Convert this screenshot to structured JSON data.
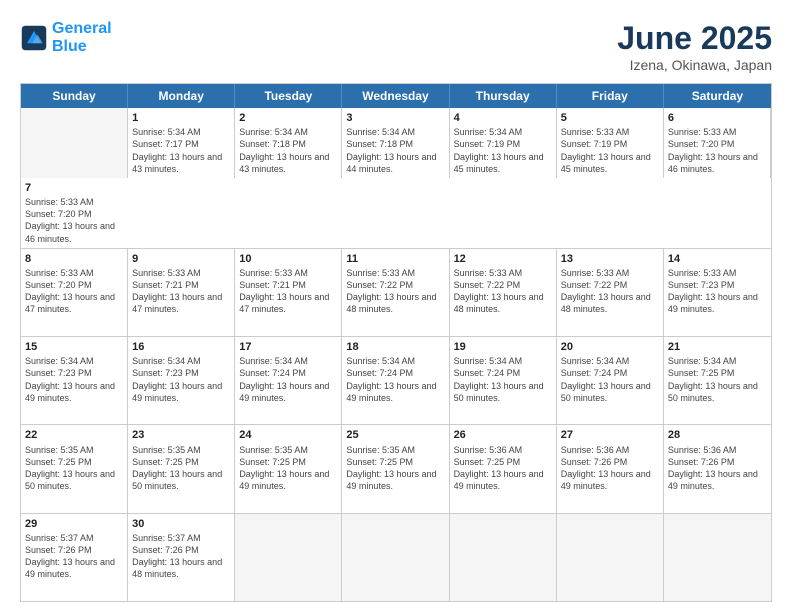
{
  "logo": {
    "line1": "General",
    "line2": "Blue"
  },
  "title": "June 2025",
  "location": "Izena, Okinawa, Japan",
  "header_days": [
    "Sunday",
    "Monday",
    "Tuesday",
    "Wednesday",
    "Thursday",
    "Friday",
    "Saturday"
  ],
  "rows": [
    [
      {
        "day": "",
        "empty": true
      },
      {
        "day": "1",
        "sunrise": "5:34 AM",
        "sunset": "7:17 PM",
        "daylight": "13 hours and 43 minutes."
      },
      {
        "day": "2",
        "sunrise": "5:34 AM",
        "sunset": "7:18 PM",
        "daylight": "13 hours and 43 minutes."
      },
      {
        "day": "3",
        "sunrise": "5:34 AM",
        "sunset": "7:18 PM",
        "daylight": "13 hours and 44 minutes."
      },
      {
        "day": "4",
        "sunrise": "5:34 AM",
        "sunset": "7:19 PM",
        "daylight": "13 hours and 45 minutes."
      },
      {
        "day": "5",
        "sunrise": "5:33 AM",
        "sunset": "7:19 PM",
        "daylight": "13 hours and 45 minutes."
      },
      {
        "day": "6",
        "sunrise": "5:33 AM",
        "sunset": "7:20 PM",
        "daylight": "13 hours and 46 minutes."
      },
      {
        "day": "7",
        "sunrise": "5:33 AM",
        "sunset": "7:20 PM",
        "daylight": "13 hours and 46 minutes."
      }
    ],
    [
      {
        "day": "8",
        "sunrise": "5:33 AM",
        "sunset": "7:20 PM",
        "daylight": "13 hours and 47 minutes."
      },
      {
        "day": "9",
        "sunrise": "5:33 AM",
        "sunset": "7:21 PM",
        "daylight": "13 hours and 47 minutes."
      },
      {
        "day": "10",
        "sunrise": "5:33 AM",
        "sunset": "7:21 PM",
        "daylight": "13 hours and 47 minutes."
      },
      {
        "day": "11",
        "sunrise": "5:33 AM",
        "sunset": "7:22 PM",
        "daylight": "13 hours and 48 minutes."
      },
      {
        "day": "12",
        "sunrise": "5:33 AM",
        "sunset": "7:22 PM",
        "daylight": "13 hours and 48 minutes."
      },
      {
        "day": "13",
        "sunrise": "5:33 AM",
        "sunset": "7:22 PM",
        "daylight": "13 hours and 48 minutes."
      },
      {
        "day": "14",
        "sunrise": "5:33 AM",
        "sunset": "7:23 PM",
        "daylight": "13 hours and 49 minutes."
      }
    ],
    [
      {
        "day": "15",
        "sunrise": "5:34 AM",
        "sunset": "7:23 PM",
        "daylight": "13 hours and 49 minutes."
      },
      {
        "day": "16",
        "sunrise": "5:34 AM",
        "sunset": "7:23 PM",
        "daylight": "13 hours and 49 minutes."
      },
      {
        "day": "17",
        "sunrise": "5:34 AM",
        "sunset": "7:24 PM",
        "daylight": "13 hours and 49 minutes."
      },
      {
        "day": "18",
        "sunrise": "5:34 AM",
        "sunset": "7:24 PM",
        "daylight": "13 hours and 49 minutes."
      },
      {
        "day": "19",
        "sunrise": "5:34 AM",
        "sunset": "7:24 PM",
        "daylight": "13 hours and 50 minutes."
      },
      {
        "day": "20",
        "sunrise": "5:34 AM",
        "sunset": "7:24 PM",
        "daylight": "13 hours and 50 minutes."
      },
      {
        "day": "21",
        "sunrise": "5:34 AM",
        "sunset": "7:25 PM",
        "daylight": "13 hours and 50 minutes."
      }
    ],
    [
      {
        "day": "22",
        "sunrise": "5:35 AM",
        "sunset": "7:25 PM",
        "daylight": "13 hours and 50 minutes."
      },
      {
        "day": "23",
        "sunrise": "5:35 AM",
        "sunset": "7:25 PM",
        "daylight": "13 hours and 50 minutes."
      },
      {
        "day": "24",
        "sunrise": "5:35 AM",
        "sunset": "7:25 PM",
        "daylight": "13 hours and 49 minutes."
      },
      {
        "day": "25",
        "sunrise": "5:35 AM",
        "sunset": "7:25 PM",
        "daylight": "13 hours and 49 minutes."
      },
      {
        "day": "26",
        "sunrise": "5:36 AM",
        "sunset": "7:25 PM",
        "daylight": "13 hours and 49 minutes."
      },
      {
        "day": "27",
        "sunrise": "5:36 AM",
        "sunset": "7:26 PM",
        "daylight": "13 hours and 49 minutes."
      },
      {
        "day": "28",
        "sunrise": "5:36 AM",
        "sunset": "7:26 PM",
        "daylight": "13 hours and 49 minutes."
      }
    ],
    [
      {
        "day": "29",
        "sunrise": "5:37 AM",
        "sunset": "7:26 PM",
        "daylight": "13 hours and 49 minutes."
      },
      {
        "day": "30",
        "sunrise": "5:37 AM",
        "sunset": "7:26 PM",
        "daylight": "13 hours and 48 minutes."
      },
      {
        "day": "",
        "empty": true
      },
      {
        "day": "",
        "empty": true
      },
      {
        "day": "",
        "empty": true
      },
      {
        "day": "",
        "empty": true
      },
      {
        "day": "",
        "empty": true
      }
    ]
  ]
}
